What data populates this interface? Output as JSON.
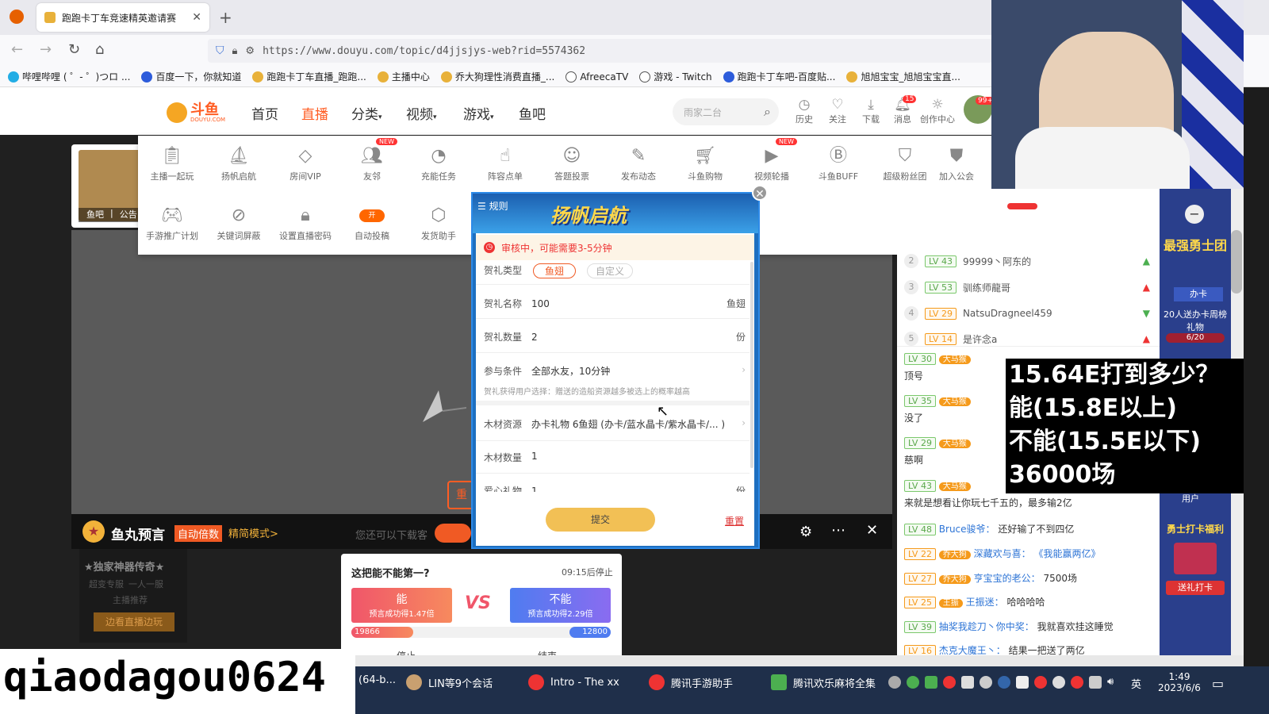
{
  "browser": {
    "tab_title": "跑跑卡丁车竞速精英邀请赛",
    "url": "https://www.douyu.com/topic/d4jjsjys-web?rid=5574362",
    "bookmarks": [
      "哔哩哔哩 ( ゜- ゜)つロ ...",
      "百度一下，你就知道",
      "跑跑卡丁车直播_跑跑...",
      "主播中心",
      "乔大狗理性消费直播_...",
      "AfreecaTV",
      "游戏 - Twitch",
      "跑跑卡丁车吧-百度贴...",
      "旭旭宝宝_旭旭宝宝直..."
    ]
  },
  "site": {
    "logo_text": "斗鱼",
    "logo_sub": "DOUYU.COM",
    "nav": [
      "首页",
      "直播",
      "分类",
      "视频",
      "游戏",
      "鱼吧"
    ],
    "search_placeholder": "雨家二台",
    "header_icons": [
      "历史",
      "关注",
      "下载",
      "消息",
      "创作中心"
    ],
    "msg_count": "15",
    "avatar_badge": "99+"
  },
  "tools_row1": [
    "主播一起玩",
    "扬帆启航",
    "房间VIP",
    "友邻",
    "充能任务",
    "阵容点单",
    "答题投票",
    "发布动态",
    "斗鱼购物",
    "视频轮播",
    "斗鱼BUFF",
    "超级粉丝团",
    "加入公会"
  ],
  "tools_row2": [
    "手游推广计划",
    "关键词屏蔽",
    "设置直播密码",
    "自动投稿",
    "发货助手"
  ],
  "toggle_label": "开",
  "new_tag": "NEW",
  "left_card": {
    "label1": "鱼吧",
    "label2": "公告"
  },
  "dialog": {
    "rules": "规则",
    "banner": "扬帆启航",
    "notice": "审核中，可能需要3-5分钟",
    "type_label": "贺礼类型",
    "type_opt1": "鱼翅",
    "type_opt2": "自定义",
    "name_label": "贺礼名称",
    "name_value": "100",
    "name_unit": "鱼翅",
    "qty_label": "贺礼数量",
    "qty_value": "2",
    "qty_unit": "份",
    "cond_label": "参与条件",
    "cond_value": "全部水友，10分钟",
    "cond_note": "贺礼获得用户选择：赠送的造船资源越多被选上的概率越高",
    "wood_label": "木材资源",
    "wood_value": "办卡礼物 6鱼翅 (办卡/蓝水晶卡/紫水晶卡/... )",
    "wood_qty_label": "木材数量",
    "wood_qty_value": "1",
    "extra_label": "爱心礼物",
    "extra_value": "1",
    "extra_unit": "份",
    "submit": "提交",
    "reset": "重置"
  },
  "bottombar": {
    "title": "鱼丸预言",
    "auto": "自动倍数",
    "mode": "精简模式>",
    "hint": "您还可以下载客",
    "left_promo": "★独家神器传奇★",
    "left_sub1": "超变专服",
    "left_sub2": "一人一服",
    "left_sub3": "主播推荐",
    "left_btn": "边看直播边玩"
  },
  "prediction": {
    "question": "这把能不能第一?",
    "timer": "09:15后停止",
    "yes": "能",
    "yes_odds": "预言成功得1.47倍",
    "no": "不能",
    "no_odds": "预言成功得2.29倍",
    "vs": "VS",
    "yes_count": "19866",
    "no_count": "12800",
    "yes_fraction": 0.61,
    "tab1": "停止",
    "tab2": "结束"
  },
  "rank": [
    {
      "no": "2",
      "lv": "LV 43",
      "name": "99999丶阿东的",
      "dir": "up-green"
    },
    {
      "no": "3",
      "lv": "LV 53",
      "name": "驯练师龍哥",
      "dir": "up-red"
    },
    {
      "no": "4",
      "lv": "LV 29",
      "name": "NatsuDragneel459",
      "dir": "down-green"
    },
    {
      "no": "5",
      "lv": "LV 14",
      "name": "是许念a",
      "dir": "up-red"
    }
  ],
  "chat": [
    {
      "lv": "LV 30",
      "badge": "大马猴",
      "name": "",
      "text": "顶号"
    },
    {
      "lv": "LV 35",
      "badge": "大马猴",
      "name": "",
      "text": "没了"
    },
    {
      "lv": "LV 29",
      "badge": "大马猴",
      "name": "",
      "text": "慈啊"
    },
    {
      "lv": "LV 43",
      "badge": "大马猴",
      "name": "",
      "text": "来就是想看让你玩七千五的，最多输2亿"
    },
    {
      "lv": "LV 48",
      "badge": "",
      "name": "Bruce骏爷：",
      "text": "还好输了不到四亿"
    },
    {
      "lv": "LV 22",
      "badge": "乔大狗",
      "name": "深藏欢与喜：",
      "text": "《我能赢两亿》"
    },
    {
      "lv": "LV 27",
      "badge": "乔大狗",
      "name": "亨宝宝的老公：",
      "text": "7500场"
    },
    {
      "lv": "LV 25",
      "badge": "王振",
      "name": "王振迷：",
      "text": "哈哈哈哈"
    },
    {
      "lv": "LV 39",
      "badge": "",
      "name": "抽奖我趁刀丶你中奖：",
      "text": "我就喜欢挂这睡觉"
    },
    {
      "lv": "LV 16",
      "badge": "",
      "name": "杰克大魔王丶：",
      "text": "结果一把送了两亿"
    }
  ],
  "promo": {
    "title": "最强勇士团",
    "card": "办卡",
    "desc": "20人送办卡周榜礼物",
    "progress": "6/20",
    "user": "用户",
    "title2": "勇士打卡福利",
    "btn": "送礼打卡"
  },
  "overlay_text": [
    "15.64E打到多少？",
    "能(15.8E以上)",
    "不能(15.5E以下)",
    "36000场"
  ],
  "streamer_id": "qiaodagou0624",
  "taskbar": {
    "items": [
      "(64-b...",
      "LIN等9个会话",
      "Intro - The xx",
      "腾讯手游助手",
      "腾讯欢乐麻将全集"
    ],
    "ime": "英",
    "time": "1:49",
    "date": "2023/6/6"
  }
}
